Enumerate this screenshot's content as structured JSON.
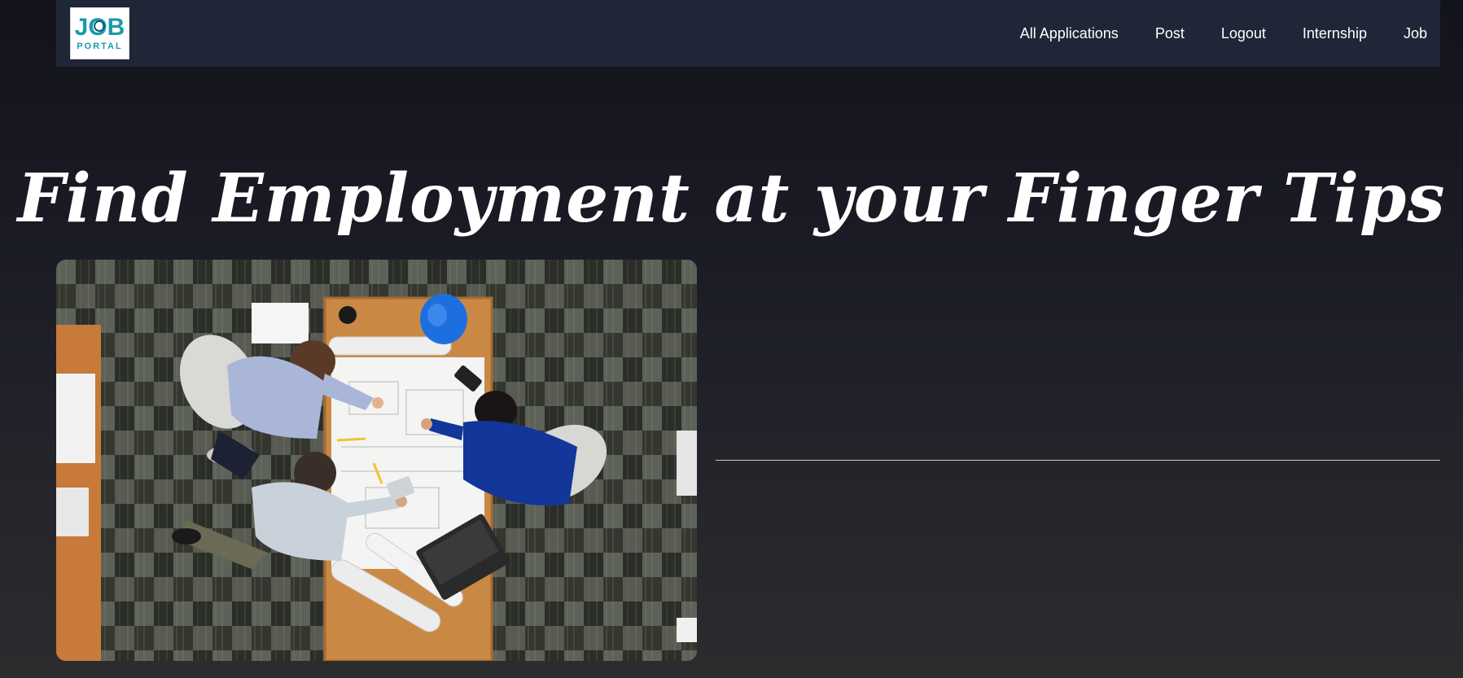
{
  "logo": {
    "line1": "JOB",
    "line2": "PORTAL"
  },
  "nav": {
    "items": [
      {
        "label": "All Applications"
      },
      {
        "label": "Post"
      },
      {
        "label": "Logout"
      },
      {
        "label": "Internship"
      },
      {
        "label": "Job"
      }
    ]
  },
  "hero": {
    "title": "Find Employment at your Finger Tips"
  },
  "colors": {
    "navbar_bg": "#1f2637",
    "page_bg_top": "#13131c",
    "page_bg_bottom": "#2c2c2e",
    "logo_teal": "#1b9aaa",
    "helmet_blue": "#1d6fe0"
  },
  "icons": {
    "logo": "job-portal-logo"
  }
}
